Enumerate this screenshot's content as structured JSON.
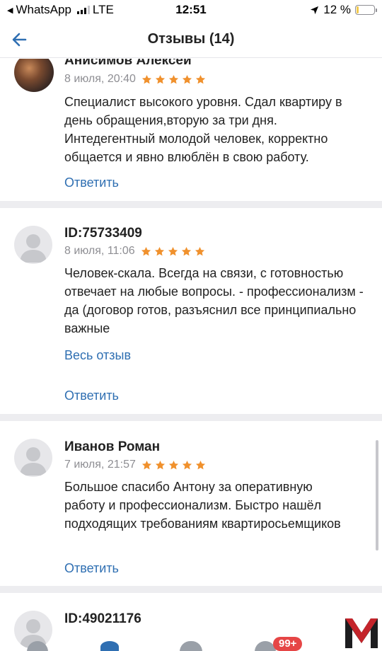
{
  "status_bar": {
    "back_app": "WhatsApp",
    "network": "LTE",
    "time": "12:51",
    "battery_percent": "12 %",
    "battery_level": 0.12,
    "signal_bars": 3
  },
  "nav": {
    "title": "Отзывы (14)",
    "back_icon": "arrow-left-icon"
  },
  "reviews": [
    {
      "author": "Анисимов Алексей",
      "date": "8 июля, 20:40",
      "rating": 5,
      "text": "Специалист высокого уровня. Сдал квартиру в день обращения,вторую за три дня. Интедегентный молодой человек, корректно общается и явно влюблён в свою работу.",
      "reply_label": "Ответить"
    },
    {
      "author": "ID:75733409",
      "date": "8 июля, 11:06",
      "rating": 5,
      "text": "Человек-скала. Всегда на связи, с готовностью отвечает на любые вопросы. - профессионализм - да (договор готов, разъяснил все принципиально важные",
      "more_label": "Весь отзыв",
      "reply_label": "Ответить"
    },
    {
      "author": "Иванов Роман",
      "date": "7 июля, 21:57",
      "rating": 5,
      "text": "Большое спасибо Антону за оперативную работу и профессионализм. Быстро нашёл подходящих требованиям квартиросьемщиков",
      "reply_label": "Ответить"
    },
    {
      "author": "ID:49021176"
    }
  ],
  "tab_bar": {
    "badge": "99+"
  },
  "colors": {
    "accent": "#2f6fb2",
    "star": "#f0912d",
    "badge": "#e64646",
    "divider": "#ededf0"
  }
}
